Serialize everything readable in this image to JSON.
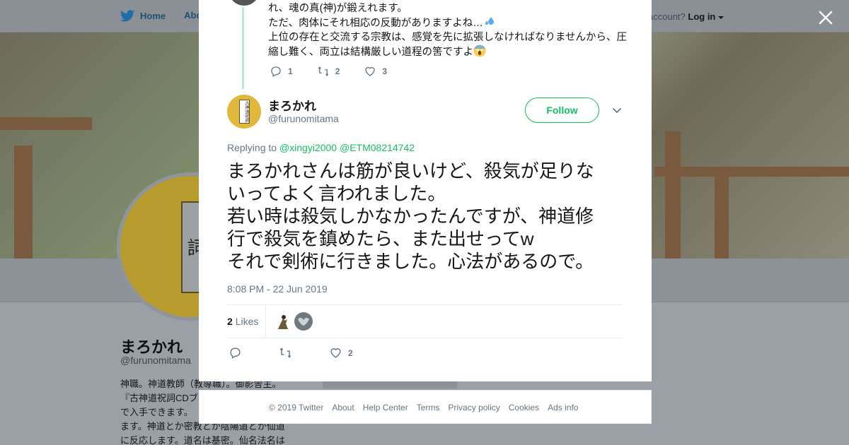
{
  "background": {
    "nav": {
      "home": "Home",
      "about": "About"
    },
    "login": {
      "prefix": "account?",
      "link": "Log in"
    },
    "profile": {
      "name": "まろかれ",
      "handle": "@furunomitama",
      "avatar_text": "古神道祝詞",
      "bio_lines": [
        "神職。神道教師（教導職）。御影舎主。",
        "『古神道祝詞CDブ",
        "で入手できます。",
        "ます。神道とか密教とか陰陽道とか仙道",
        "に反応します。道名は基密。仙名法名は"
      ]
    }
  },
  "modal": {
    "previous_tweet": {
      "lines": [
        "れ、魂の真(神)が鍛えれます。",
        "ただ、肉体にそれ相応の反動がありますよね…",
        "上位の存在と交流する宗教は、感覚を先に拡張しなければなりませんから、圧",
        "縮し難く、両立は結構厳しい道程の筈ですよ"
      ],
      "replies": "1",
      "retweets": "2",
      "likes": "3"
    },
    "tweet": {
      "author_name": "まろかれ",
      "author_handle": "@furunomitama",
      "avatar_text": "古神道祝詞",
      "follow_label": "Follow",
      "replying_prefix": "Replying to",
      "replying_to": [
        "@xingyi2000",
        "@ETM08214742"
      ],
      "text_lines": [
        "まろかれさんは筋が良いけど、殺気が足りな",
        "いってよく言われました。",
        "若い時は殺気しかなかったんですが、神道修",
        "行で殺気を鎮めたら、また出せってw",
        "それで剣術に行きました。心法があるので。"
      ],
      "timestamp": "8:08 PM - 22 Jun 2019",
      "likes_count": "2",
      "likes_label": "Likes",
      "like_count_action": "2"
    }
  },
  "footer": {
    "links": [
      "© 2019 Twitter",
      "About",
      "Help Center",
      "Terms",
      "Privacy policy",
      "Cookies",
      "Ads info"
    ]
  },
  "colors": {
    "accent_green": "#17bf63",
    "thread_line": "#b9e9da",
    "muted_text": "#657786",
    "twitter_blue": "#1da1f2"
  }
}
